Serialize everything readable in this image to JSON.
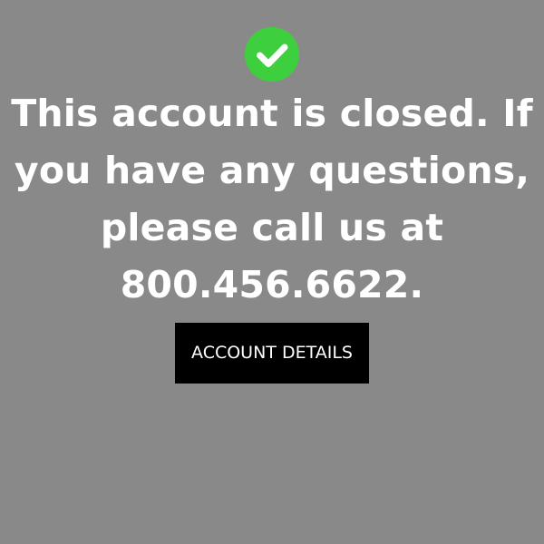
{
  "status": {
    "icon": "check-circle-icon",
    "icon_color": "#3ecf3f",
    "check_color": "#ffffff"
  },
  "message": {
    "lines": [
      "This account is closed. If",
      "you have any questions,",
      "please call us at",
      "800.456.6622."
    ]
  },
  "actions": {
    "account_details_label": "ACCOUNT DETAILS"
  },
  "colors": {
    "background": "#898989",
    "text": "#ffffff",
    "button_background": "#000000"
  }
}
